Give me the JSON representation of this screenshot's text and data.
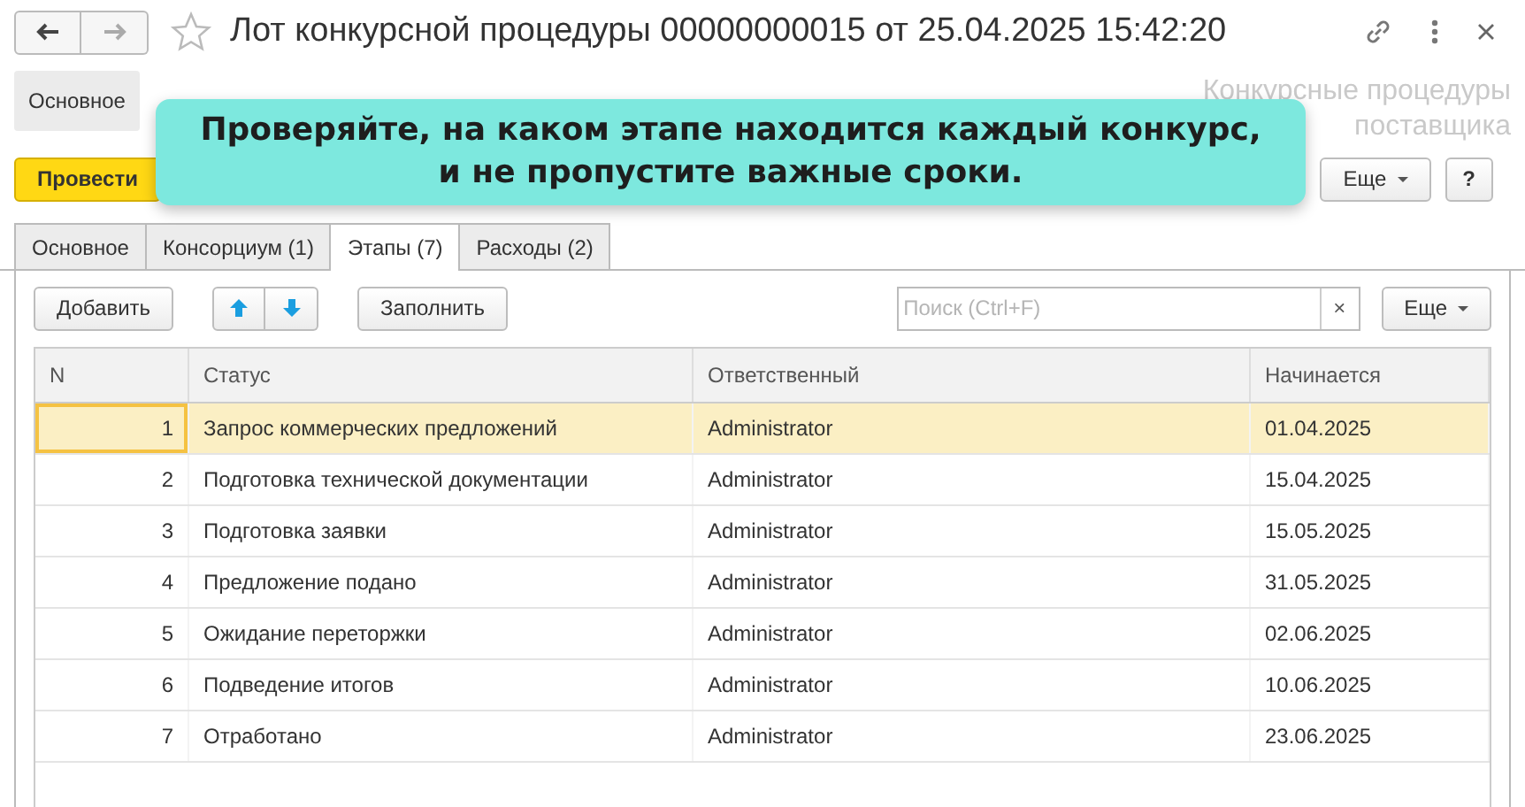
{
  "window": {
    "title": "Лот конкурсной процедуры 00000000015 от 25.04.2025 15:42:20",
    "subsystem_lines": [
      "Конкурсные процедуры",
      "поставщика"
    ]
  },
  "nav_links": [
    {
      "label": "Основное",
      "selected": true
    }
  ],
  "command_bar": {
    "primary": "Провести",
    "more": "Еще",
    "help": "?"
  },
  "callout": "Проверяйте, на каком этапе находится каждый конкурс,\nи не пропустите важные сроки.",
  "tabs": [
    {
      "label": "Основное",
      "selected": false
    },
    {
      "label": "Консорциум (1)",
      "selected": false
    },
    {
      "label": "Этапы (7)",
      "selected": true
    },
    {
      "label": "Расходы (2)",
      "selected": false
    }
  ],
  "toolbar": {
    "add": "Добавить",
    "fill": "Заполнить",
    "search": {
      "placeholder": "Поиск (Ctrl+F)"
    },
    "clear": "×",
    "more": "Еще"
  },
  "table": {
    "columns": [
      "N",
      "Статус",
      "Ответственный",
      "Начинается"
    ],
    "rows": [
      {
        "cells": [
          "1",
          "Запрос коммерческих предложений",
          "Administrator",
          "01.04.2025"
        ],
        "selected": true
      },
      {
        "cells": [
          "2",
          "Подготовка технической документации",
          "Administrator",
          "15.04.2025"
        ],
        "selected": false
      },
      {
        "cells": [
          "3",
          "Подготовка заявки",
          "Administrator",
          "15.05.2025"
        ],
        "selected": false
      },
      {
        "cells": [
          "4",
          "Предложение подано",
          "Administrator",
          "31.05.2025"
        ],
        "selected": false
      },
      {
        "cells": [
          "5",
          "Ожидание переторжки",
          "Administrator",
          "02.06.2025"
        ],
        "selected": false
      },
      {
        "cells": [
          "6",
          "Подведение итогов",
          "Administrator",
          "10.06.2025"
        ],
        "selected": false
      },
      {
        "cells": [
          "7",
          "Отработано",
          "Administrator",
          "23.06.2025"
        ],
        "selected": false
      }
    ]
  }
}
